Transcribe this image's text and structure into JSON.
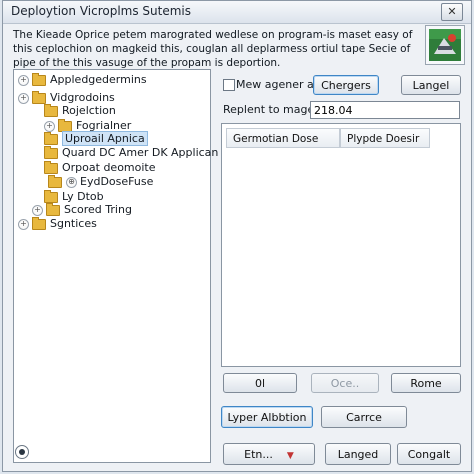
{
  "window": {
    "title": "Deploytion Vicroplms Sutemis",
    "close_glyph": "✕"
  },
  "description": "The Kieade Oprice petem marograted wedlese on program-is maset easy of this ceplochion on magkeid this, couglan all deplarmess ortiul tape Secie of pipe of the this vasuge of the propam is deportion.",
  "tree": {
    "items": [
      {
        "label": "Appledgedermins",
        "expander": "+",
        "icon": "folder"
      },
      {
        "label": "Vidgrodoins",
        "expander": "+",
        "icon": "folder"
      },
      {
        "label": "Rojelction",
        "expander": "",
        "icon": "folder"
      },
      {
        "label": "Fogrialner",
        "expander": "+",
        "icon": "folder"
      },
      {
        "label": "Uproail Apnica",
        "expander": "",
        "icon": "folder",
        "selected": true
      },
      {
        "label": "Quard DC Amer DK Applican",
        "expander": "",
        "icon": "folder"
      },
      {
        "label": "Orpoat deomoite",
        "expander": "",
        "icon": "folder"
      },
      {
        "label": "EydDoseFuse",
        "expander": "⊕",
        "icon": "folder"
      },
      {
        "label": "Ly Dtob",
        "expander": "",
        "icon": "folder"
      },
      {
        "label": "Scored Tring",
        "expander": "+",
        "icon": "folder"
      },
      {
        "label": "Sgntices",
        "expander": "+",
        "icon": "folder"
      }
    ]
  },
  "options": {
    "checkbox_label": "Mew agener aw",
    "changes_button": "Chergers",
    "langel_button": "Langel",
    "replent_label": "Replent to mage",
    "replent_value": "218.04"
  },
  "list": {
    "columns": [
      "Germotian Dose",
      "Plypde Doesir"
    ]
  },
  "buttons": {
    "row1": [
      "0l",
      "Oce..",
      "Rome"
    ],
    "row2": [
      "Lyper Albbtion",
      "Carrce"
    ],
    "bottom": {
      "dropdown": "Etn...",
      "dropdown_arrow": "▼",
      "langed": "Langed",
      "congalt": "Congalt"
    }
  }
}
